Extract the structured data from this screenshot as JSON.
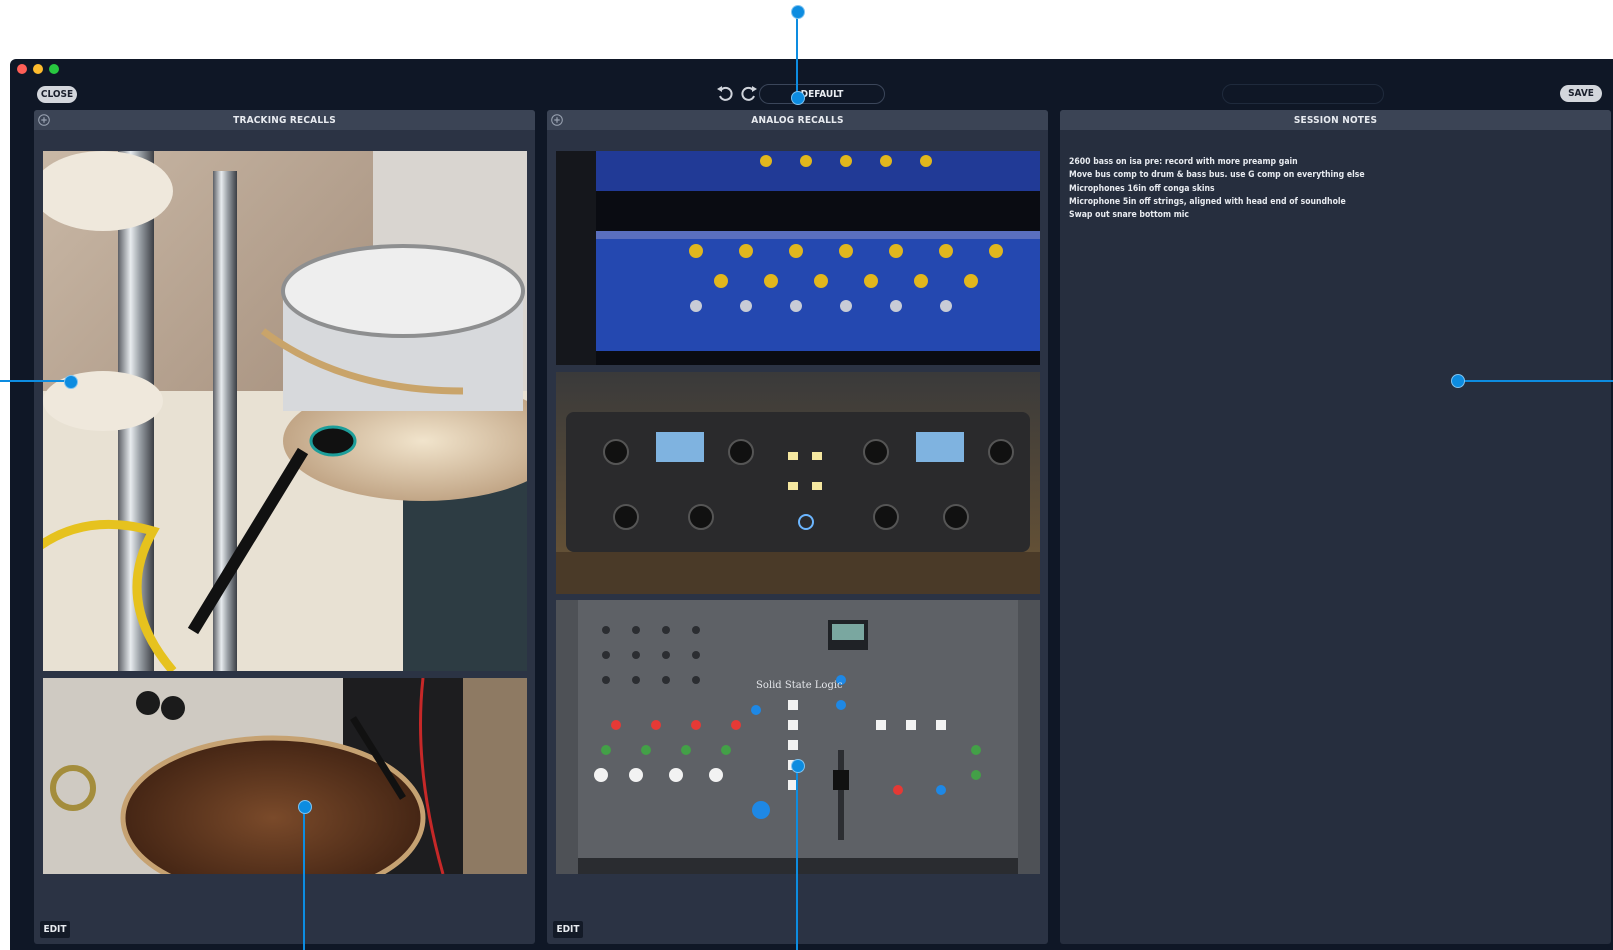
{
  "toolbar": {
    "close_label": "CLOSE",
    "save_label": "SAVE",
    "preset_name": "DEFAULT",
    "undo_icon": "undo-icon",
    "redo_icon": "redo-icon"
  },
  "panels": [
    {
      "title": "TRACKING RECALLS",
      "edit_label": "EDIT",
      "photos": [
        {
          "alt": "drum kit with microphones",
          "icon": "drum-kit-photo"
        },
        {
          "alt": "conga drum with microphone",
          "icon": "conga-photo"
        }
      ]
    },
    {
      "title": "ANALOG RECALLS",
      "edit_label": "EDIT",
      "photos": [
        {
          "alt": "Focusrite rack preamps",
          "icon": "focusrite-rack-photo"
        },
        {
          "alt": "McIntosh style stereo compressor",
          "icon": "compressor-photo"
        },
        {
          "alt": "Solid State Logic Origin console",
          "icon": "ssl-console-photo",
          "brand_text": "Solid State Logic"
        }
      ]
    },
    {
      "title": "SESSION NOTES",
      "notes": [
        "2600 bass on isa pre: record with more preamp gain",
        "Move bus comp to drum & bass bus. use G comp on everything else",
        "Microphones 16in off conga skins",
        "Microphone 5in off strings, aligned with head end of soundhole",
        "Swap out snare bottom mic"
      ]
    }
  ],
  "colors": {
    "window_bg": "#0f1726",
    "panel_bg": "#2b3344",
    "panel_header": "#3b4455",
    "callout": "#0d8ce0"
  }
}
